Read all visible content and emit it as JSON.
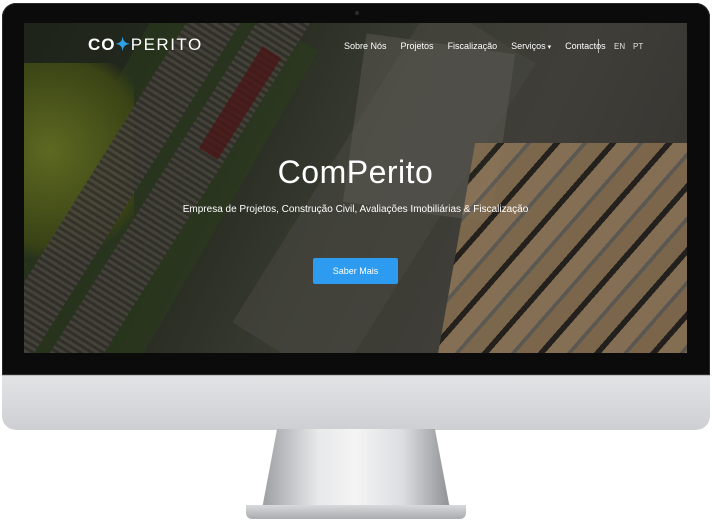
{
  "brand": {
    "logo_head": "CO",
    "logo_mark": "✦",
    "logo_tail": "PERITO"
  },
  "nav": {
    "items": [
      {
        "label": "Sobre Nós"
      },
      {
        "label": "Projetos"
      },
      {
        "label": "Fiscalização"
      },
      {
        "label": "Serviços"
      },
      {
        "label": "Contactos"
      }
    ],
    "dropdown_caret": "▾",
    "languages": [
      "EN",
      "PT"
    ]
  },
  "hero": {
    "title": "ComPerito",
    "subtitle": "Empresa de Projetos, Construção Civil, Avaliações Imobiliárias & Fiscalização",
    "cta_label": "Saber Mais"
  },
  "colors": {
    "accent": "#2d9bef",
    "logo_mark": "#2fa1e8",
    "text": "#ffffff"
  }
}
